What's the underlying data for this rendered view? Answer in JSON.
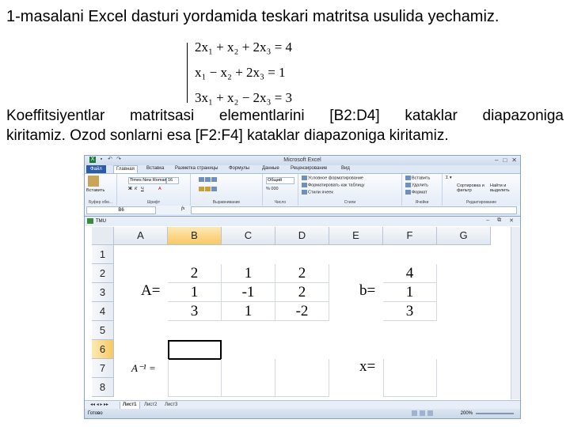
{
  "slide": {
    "title": "1-masalani  Excel dasturi yordamida teskari matritsa usulida yechamiz.",
    "equations": [
      "2x₁ + x₂ + 2x₃ = 4",
      "x₁ − x₂ + 2x₃ = 1",
      "3x₁ + x₂ − 2x₃ = 3"
    ],
    "paragraph_line1": "Koeffitsiyentlar matritsasi elementlarini [B2:D4] kataklar diapazoniga",
    "paragraph_line2": "kiritamiz. Ozod sonlarni esa  [F2:F4] kataklar diapazoniga kiritamiz."
  },
  "excel": {
    "window_title": "Microsoft Excel",
    "menu": [
      "Файл",
      "Главная",
      "Вставка",
      "Разметка страницы",
      "Формулы",
      "Данные",
      "Рецензирование",
      "Вид"
    ],
    "ribbon": {
      "paste": "Вставить",
      "font_name": "Times New Roman",
      "font_size": "16",
      "number_format": "Общий",
      "cond_format": "Условное форматирование",
      "format_table": "Форматировать как таблицу",
      "cell_styles": "Стили ячеек",
      "insert": "Вставить",
      "delete": "Удалить",
      "format": "Формат",
      "sort": "Сортировка и фильтр",
      "find": "Найти и выделить",
      "groups": [
        "Буфер обм...",
        "Шрифт",
        "Выравнивание",
        "Число",
        "Стили",
        "Ячейки",
        "Редактирование"
      ]
    },
    "name_box": "B6",
    "fx": "fx",
    "workbook_title": "TMU",
    "columns": [
      "A",
      "B",
      "C",
      "D",
      "E",
      "F",
      "G"
    ],
    "rows": [
      "1",
      "2",
      "3",
      "4",
      "5",
      "6",
      "7",
      "8"
    ],
    "matrix": [
      [
        "2",
        "1",
        "2"
      ],
      [
        "1",
        "-1",
        "2"
      ],
      [
        "3",
        "1",
        "-2"
      ]
    ],
    "b_vector": [
      "4",
      "1",
      "3"
    ],
    "label_A": "A=",
    "label_b": "b=",
    "label_Ainv": "A⁻¹ =",
    "label_x": "x=",
    "sheets": [
      "Лист1",
      "Лист2",
      "Лист3"
    ],
    "status": "Готово",
    "zoom": "200%"
  }
}
